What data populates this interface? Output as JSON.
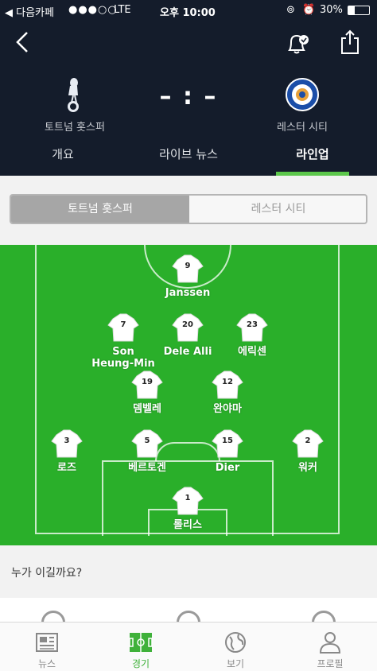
{
  "status_bar": {
    "carrier": "다음카페",
    "network": "LTE",
    "time": "오후 10:00",
    "battery": "30%"
  },
  "match": {
    "home_team": "토트넘 홋스퍼",
    "away_team": "레스터 시티",
    "score": "– : –"
  },
  "tabs": [
    {
      "label": "개요",
      "active": false
    },
    {
      "label": "라이브 뉴스",
      "active": false
    },
    {
      "label": "라인업",
      "active": true
    }
  ],
  "team_toggle": {
    "selected": "토트넘 홋스퍼",
    "other": "레스터 시티"
  },
  "lineup": [
    {
      "number": "9",
      "name": "Janssen"
    },
    {
      "number": "7",
      "name": "Son Heung-Min"
    },
    {
      "number": "20",
      "name": "Dele Alli"
    },
    {
      "number": "23",
      "name": "에릭센"
    },
    {
      "number": "19",
      "name": "뎀벨레"
    },
    {
      "number": "12",
      "name": "완야마"
    },
    {
      "number": "3",
      "name": "로즈"
    },
    {
      "number": "5",
      "name": "베르토겐"
    },
    {
      "number": "15",
      "name": "Dier"
    },
    {
      "number": "2",
      "name": "워커"
    },
    {
      "number": "1",
      "name": "롤리스"
    }
  ],
  "prediction": {
    "title": "누가 이길까요?"
  },
  "bottom_nav": [
    {
      "label": "뉴스",
      "icon": "newspaper-icon",
      "active": false
    },
    {
      "label": "경기",
      "icon": "pitch-icon",
      "active": true
    },
    {
      "label": "보기",
      "icon": "globe-icon",
      "active": false
    },
    {
      "label": "프로필",
      "icon": "person-icon",
      "active": false
    }
  ],
  "colors": {
    "header_bg": "#141c2b",
    "pitch": "#2aaf2a",
    "accent": "#5cc74b"
  }
}
